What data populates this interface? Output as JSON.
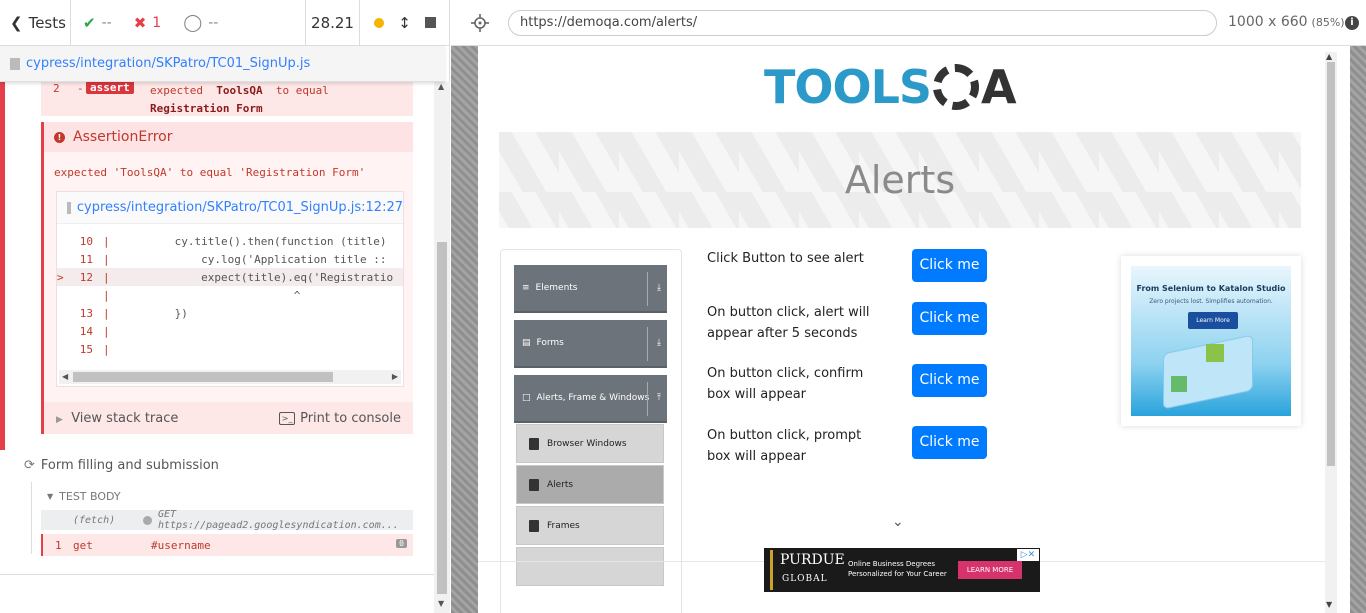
{
  "runner": {
    "tests_label": "Tests",
    "passed": "--",
    "failed": "1",
    "pending": "--",
    "duration": "28.21"
  },
  "spec_path": "cypress/integration/SKPatro/TC01_SignUp.js",
  "assert_cmd": {
    "number": "2",
    "dash": "-",
    "badge": "assert",
    "msg_prefix": "expected",
    "actual": "ToolsQA",
    "msg_mid": "to equal",
    "expected": "Registration Form"
  },
  "error": {
    "title": "AssertionError",
    "message": "expected 'ToolsQA' to equal 'Registration Form'",
    "frame_path": "cypress/integration/SKPatro/TC01_SignUp.js:12:27",
    "lines": [
      {
        "n": "10",
        "code": "        cy.title().then(function (title)",
        "hl": false,
        "arrow": ""
      },
      {
        "n": "11",
        "code": "            cy.log('Application title :: ",
        "hl": false,
        "arrow": ""
      },
      {
        "n": "12",
        "code": "            expect(title).eq('Registratio",
        "hl": true,
        "arrow": ">"
      },
      {
        "n": "",
        "code": "                          ^",
        "hl": false,
        "arrow": ""
      },
      {
        "n": "13",
        "code": "        })",
        "hl": false,
        "arrow": ""
      },
      {
        "n": "14",
        "code": "",
        "hl": false,
        "arrow": ""
      },
      {
        "n": "15",
        "code": "",
        "hl": false,
        "arrow": ""
      }
    ],
    "view_stack": "View stack trace",
    "print_console": "Print to console"
  },
  "test2": {
    "title": "Form filling and submission",
    "body_label": "TEST BODY",
    "fetch": {
      "key": "(fetch)",
      "value": "GET https://pagead2.googlesyndication.com..."
    },
    "get": {
      "num": "1",
      "cmd": "get",
      "arg": "#username",
      "count": "0"
    }
  },
  "browser": {
    "url": "https://demoqa.com/alerts/",
    "size": "1000 x 660",
    "zoom": "(85%)"
  },
  "site": {
    "logo_left": "TOOLS",
    "logo_right": "A",
    "banner_title": "Alerts",
    "groups": [
      {
        "label": "Elements",
        "icon": "≡",
        "chev": "⤓"
      },
      {
        "label": "Forms",
        "icon": "▤",
        "chev": "⤓"
      },
      {
        "label": "Alerts, Frame & Windows",
        "icon": "□",
        "chev": "⤒"
      }
    ],
    "menu_items": [
      "Browser Windows",
      "Alerts",
      "Frames"
    ],
    "rows": [
      {
        "text": "Click Button to see alert",
        "btn": "Click me"
      },
      {
        "text": "On button click, alert will appear after 5 seconds",
        "btn": "Click me"
      },
      {
        "text": "On button click, confirm box will appear",
        "btn": "Click me"
      },
      {
        "text": "On button click, prompt box will appear",
        "btn": "Click me"
      }
    ],
    "ad_side": {
      "title": "From Selenium to Katalon Studio",
      "sub": "Zero projects lost. Simplifies automation.",
      "btn": "Learn More"
    },
    "ad_bottom": {
      "brand": "PURDUE",
      "brand_sub": "GLOBAL",
      "text1": "Online Business Degrees",
      "text2": "Personalized for Your Career",
      "cta": "LEARN MORE",
      "close": "▷✕"
    }
  }
}
